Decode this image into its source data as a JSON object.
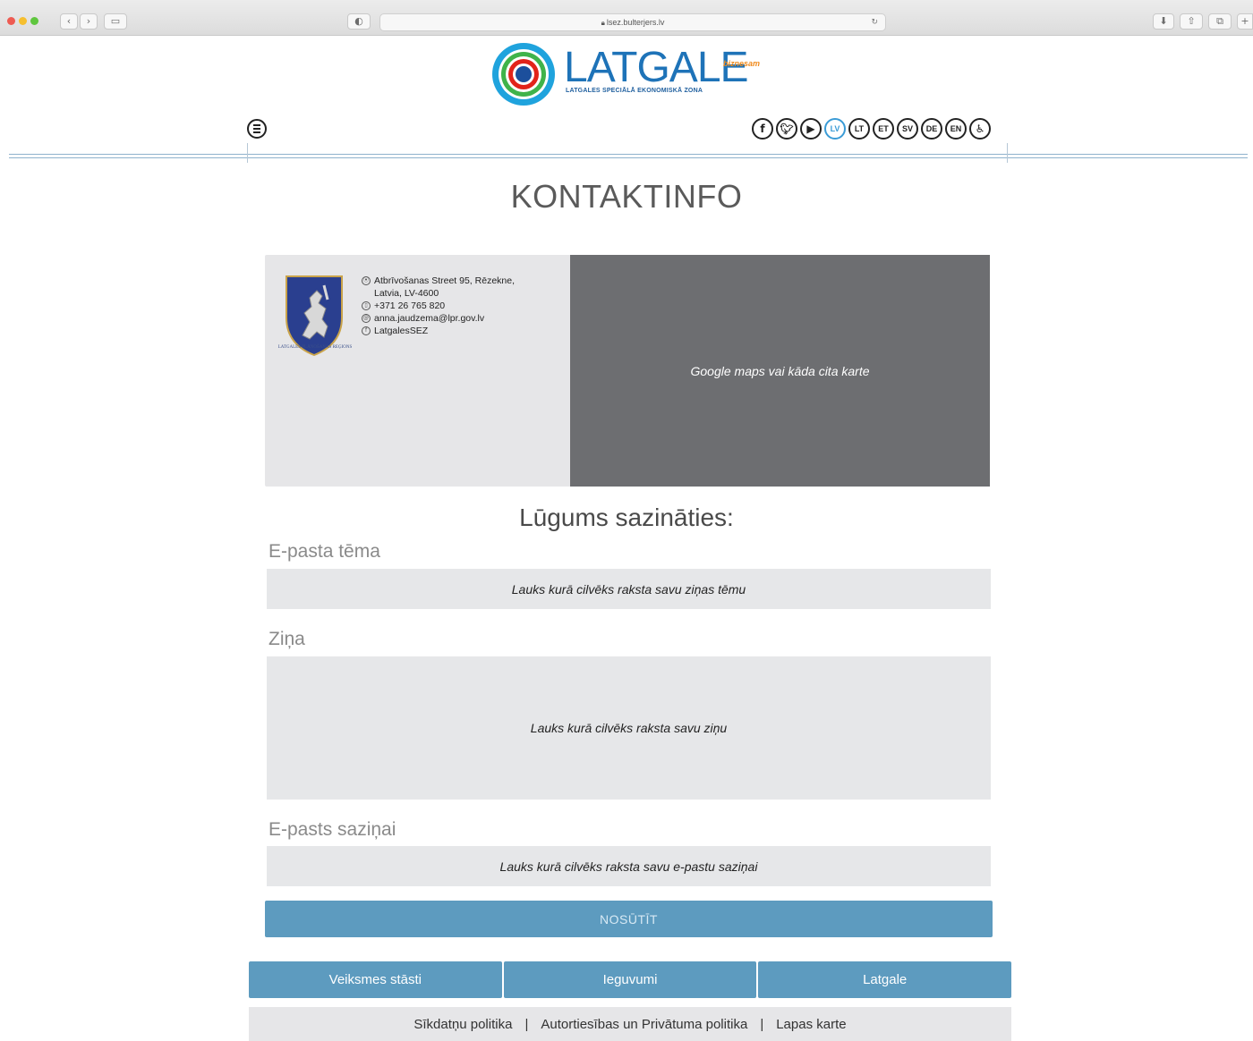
{
  "browser": {
    "url": "lsez.bulterjers.lv",
    "reload_icon": "reload-icon"
  },
  "header": {
    "logo_title": "LATGALE",
    "logo_tagline": "biznesam",
    "logo_subtitle": "LATGALES SPECIĀLĀ EKONOMISKĀ ZONA",
    "social_icons": [
      "facebook-icon",
      "twitter-icon",
      "youtube-icon"
    ],
    "languages": [
      "LV",
      "LT",
      "ET",
      "SV",
      "DE",
      "EN"
    ],
    "active_language": "LV",
    "accessibility_icon": "accessibility-icon"
  },
  "page": {
    "title": "KONTAKTINFO"
  },
  "contact": {
    "crest_caption": "LATGALES PLĀNOŠANAS REĢIONS",
    "address_line1": "Atbrīvošanas Street 95, Rēzekne,",
    "address_line2": "Latvia, LV-4600",
    "phone": "+371 26 765 820",
    "email": "anna.jaudzema@lpr.gov.lv",
    "facebook": "LatgalesSEZ"
  },
  "map": {
    "placeholder": "Google maps vai kāda cita karte"
  },
  "form": {
    "title": "Lūgums sazināties:",
    "subject_label": "E-pasta tēma",
    "subject_placeholder": "Lauks kurā cilvēks raksta savu ziņas tēmu",
    "message_label": "Ziņa",
    "message_placeholder": "Lauks kurā cilvēks raksta savu ziņu",
    "email_label": "E-pasts saziņai",
    "email_placeholder": "Lauks kurā cilvēks raksta savu e-pastu saziņai",
    "submit_label": "NOSŪTĪT"
  },
  "footer": {
    "nav": [
      "Veiksmes stāsti",
      "Ieguvumi",
      "Latgale"
    ],
    "legal": [
      "Sīkdatņu politika",
      "Autortiesības un Privātuma politika",
      "Lapas karte"
    ],
    "separator": "|"
  },
  "colors": {
    "accent_blue": "#5d9bbf",
    "logo_blue": "#1e73b8",
    "map_gray": "#6d6e71",
    "field_gray": "#e6e7e9"
  }
}
